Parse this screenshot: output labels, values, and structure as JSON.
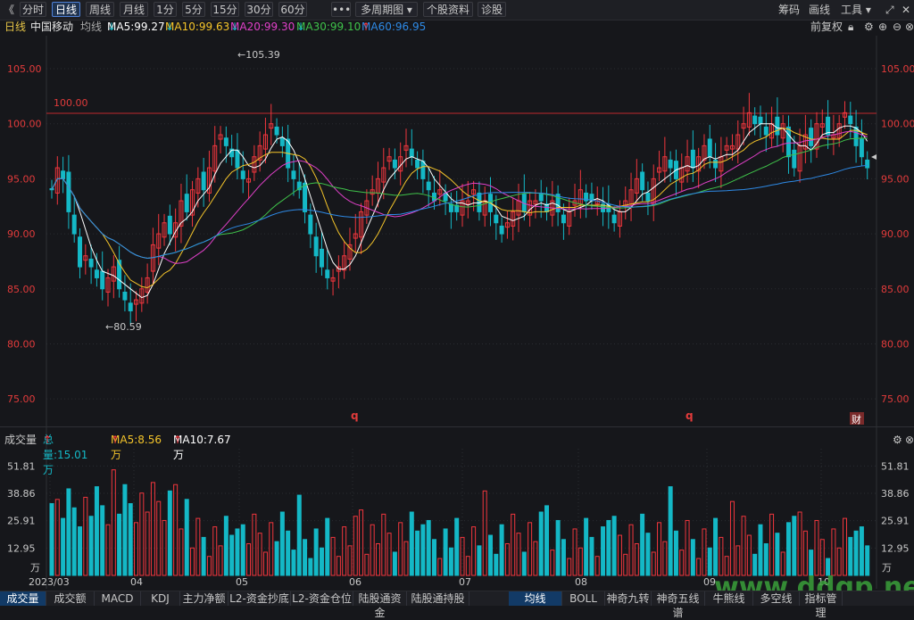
{
  "toolbar": {
    "collapse_icon": "double-chevron-left",
    "periods": [
      "分时",
      "日线",
      "周线",
      "月线",
      "1分",
      "5分",
      "15分",
      "30分",
      "60分"
    ],
    "active_period": "日线",
    "more_label": "•••",
    "multi_period_label": "多周期图",
    "profile_label": "个股资料",
    "diagnose_label": "诊股",
    "chips_label": "筹码",
    "draw_label": "画线",
    "tools_label": "工具",
    "fullscreen_icon": "expand-arrows-icon",
    "close_label": "✕"
  },
  "subbar": {
    "period": "日线",
    "stock_name": "中国移动",
    "ma_label": "均线",
    "ma5": "MA5:99.27",
    "ma10": "MA10:99.63",
    "ma20": "MA20:99.30",
    "ma30": "MA30:99.10",
    "ma60": "MA60:96.95",
    "adjust_label": "前复权",
    "colors": {
      "ma5": "#ffffff",
      "ma10": "#f5c52a",
      "ma20": "#e040c8",
      "ma30": "#3fc24a",
      "ma60": "#2e8ae6",
      "up": "#f0363d",
      "down": "#14b8c6"
    }
  },
  "price_axis": {
    "ticks": [
      "105.00",
      "100.00",
      "95.00",
      "90.00",
      "85.00",
      "80.00",
      "75.00"
    ]
  },
  "price_annotations": {
    "high": "105.39",
    "low": "80.59",
    "line": "100.00",
    "badge": "财",
    "q1": "q",
    "q2": "q"
  },
  "volume_bar": {
    "title": "成交量",
    "total": "总量:15.01万",
    "ma5": "MA5:8.56万",
    "ma10": "MA10:7.67万"
  },
  "volume_axis": {
    "ticks": [
      "51.81",
      "38.86",
      "25.91",
      "12.95"
    ],
    "unit": "万"
  },
  "date_axis": [
    "2023/03",
    "04",
    "05",
    "06",
    "07",
    "08",
    "09",
    "10"
  ],
  "bottom_tabs": [
    "成交量",
    "成交额",
    "MACD",
    "KDJ",
    "主力净额",
    "L2-资金抄底",
    "L2-资金仓位",
    "陆股通资金",
    "陆股通持股",
    "均线",
    "BOLL",
    "神奇九转",
    "神奇五线谱",
    "牛熊线",
    "多空线",
    "指标管理"
  ],
  "active_bottom_tab": "成交量",
  "watermark": "www.ddgp.net",
  "chart_data": {
    "type": "candlestick",
    "price_range": [
      72.5,
      108
    ],
    "volume_range": [
      0,
      60
    ],
    "closes": [
      94,
      96,
      95,
      92,
      90,
      87,
      88,
      87,
      86,
      85,
      86,
      87,
      85,
      84,
      83,
      84,
      85,
      86,
      89,
      90,
      91,
      90,
      91,
      93,
      92,
      94,
      95,
      94,
      96,
      98,
      99,
      98,
      97,
      96,
      95,
      95,
      97,
      98,
      99,
      100,
      99,
      98,
      96,
      95,
      94,
      92,
      90,
      88,
      87,
      86,
      86,
      87,
      88,
      89,
      90,
      92,
      93,
      94,
      95,
      96,
      97,
      96,
      97,
      98,
      97,
      96,
      95,
      94,
      93,
      94,
      93,
      92,
      92,
      93,
      93,
      94,
      92,
      93,
      92,
      91,
      90,
      91,
      92,
      93,
      92,
      93,
      93,
      93,
      92,
      93,
      92,
      91,
      92,
      93,
      94,
      93,
      93,
      93,
      92,
      92,
      91,
      92,
      93,
      94,
      95,
      94,
      93,
      95,
      96,
      97,
      96,
      95,
      96,
      97,
      96,
      97,
      98,
      97,
      96,
      97,
      98,
      98,
      99,
      100,
      101,
      100,
      100,
      99,
      100,
      99,
      100,
      97,
      96,
      98,
      99,
      98,
      100,
      100,
      99,
      99,
      100,
      101,
      100,
      98,
      97,
      96
    ]
  }
}
